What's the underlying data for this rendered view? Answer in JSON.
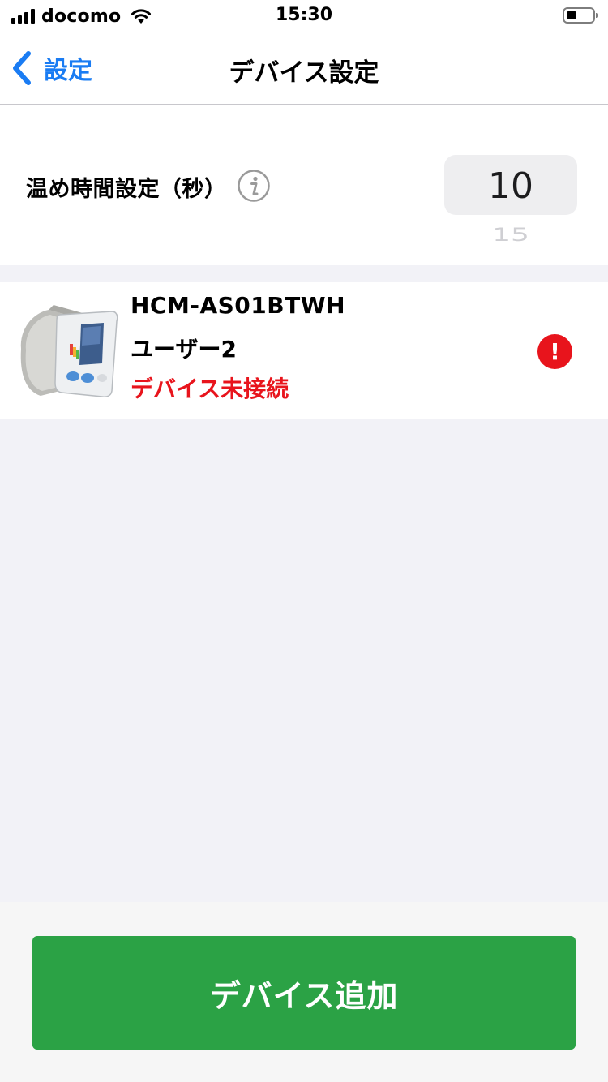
{
  "status_bar": {
    "carrier": "docomo",
    "time": "15:30"
  },
  "nav": {
    "back_label": "設定",
    "title": "デバイス設定"
  },
  "warm_time": {
    "label": "温め時間設定（秒）",
    "selected_value": "10",
    "next_value": "15"
  },
  "device": {
    "model": "HCM-AS01BTWH",
    "user": "ユーザー2",
    "status": "デバイス未接続",
    "alert_symbol": "!"
  },
  "footer": {
    "add_button_label": "デバイス追加"
  },
  "colors": {
    "accent_blue": "#1a7cf3",
    "error_red": "#e8141c",
    "button_green": "#2ba245",
    "background_gray": "#f2f2f7"
  },
  "icons": {
    "back": "chevron-left-icon",
    "info": "info-icon",
    "alert": "exclamation-circle-icon",
    "wifi": "wifi-icon",
    "signal": "signal-bars-icon",
    "battery": "battery-icon"
  }
}
